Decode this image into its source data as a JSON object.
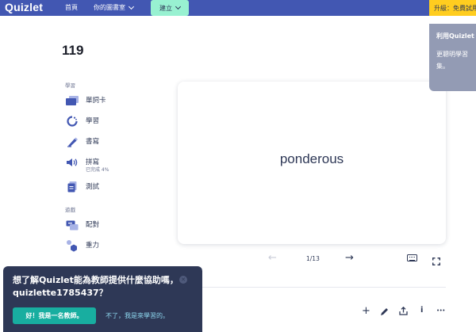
{
  "header": {
    "logo": "Quizlet",
    "home": "首頁",
    "library": "你的圖書室",
    "create": "建立",
    "upgrade": "升級：免費試用"
  },
  "set": {
    "title": "119"
  },
  "sidebar": {
    "study_label": "學習",
    "games_label": "遊戲",
    "study_modes": [
      {
        "label": "單詞卡",
        "icon": "flashcards-icon"
      },
      {
        "label": "學習",
        "icon": "learn-icon"
      },
      {
        "label": "書寫",
        "icon": "write-icon"
      },
      {
        "label": "拼寫",
        "sub": "已完成 4%",
        "icon": "spell-icon"
      },
      {
        "label": "測試",
        "icon": "test-icon"
      }
    ],
    "games": [
      {
        "label": "配對",
        "icon": "match-icon"
      },
      {
        "label": "重力",
        "icon": "gravity-icon"
      }
    ]
  },
  "card": {
    "term": "ponderous"
  },
  "pager": {
    "current_total": "1/13"
  },
  "tooltip": {
    "title": "利用Quizlet",
    "body": "更聰明學習\n集。"
  },
  "popup": {
    "message": "想了解Quizlet能為教師提供什麼協助嗎，quizlette1785437？",
    "yes_button": "好！我是一名教師。",
    "no_link": "不了，我是來學習的。"
  },
  "toolbar": {
    "add": "+",
    "info": "i",
    "more": "•••"
  },
  "colors": {
    "brand": "#4257b2",
    "create": "#98f1d1",
    "upgrade": "#ffcd1f",
    "popup": "#2e3856",
    "teal": "#18aea0"
  }
}
